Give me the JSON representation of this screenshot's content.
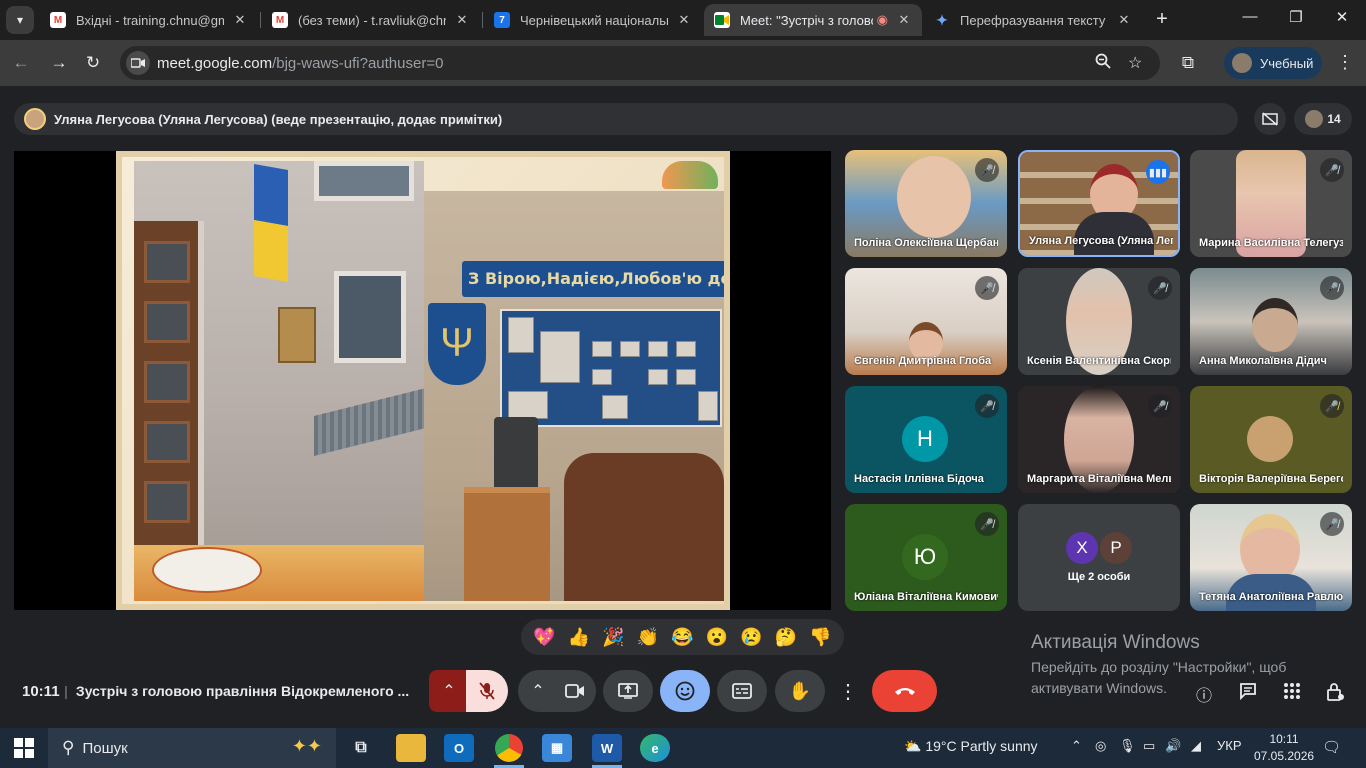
{
  "browser": {
    "tabs": [
      {
        "title": "Вхідні - training.chnu@gmail",
        "favicon": "gmail-icon"
      },
      {
        "title": "(без теми) - t.ravliuk@chnu.e",
        "favicon": "gmail-icon"
      },
      {
        "title": "Чернівецький національний",
        "favicon": "calendar-icon"
      },
      {
        "title": "Meet: \"Зустріч з головою",
        "favicon": "meet-icon"
      },
      {
        "title": "Перефразування тексту пр",
        "favicon": "gemini-icon"
      }
    ],
    "url_main": "meet.google.com",
    "url_rest": "/bjg-waws-ufi?authuser=0",
    "profile_label": "Учебный",
    "calendar_favicon_text": "7"
  },
  "meet": {
    "presenter_banner": "Уляна Легусова (Уляна Легусова) (веде презентацію, додає примітки)",
    "participant_count": "14",
    "slide": {
      "banner_text": "З Вірою,Надією,Любов'ю до Дітей",
      "trident": "Ψ"
    },
    "tiles": [
      {
        "name": "Поліна Олексіївна Щербан",
        "mic": "muted"
      },
      {
        "name": "Уляна Легусова (Уляна Легусова)",
        "mic": "speaking"
      },
      {
        "name": "Марина Василівна Телегуз",
        "mic": "muted"
      },
      {
        "name": "Євгенія Дмитрівна Глоба",
        "mic": "muted"
      },
      {
        "name": "Ксенія Валентинівна Скорик",
        "mic": "muted"
      },
      {
        "name": "Анна Миколаївна Дідич",
        "mic": "muted"
      },
      {
        "name": "Настасія Іллівна Бідоча",
        "mic": "muted",
        "initial": "Н"
      },
      {
        "name": "Маргарита Віталіївна Мельник",
        "mic": "muted"
      },
      {
        "name": "Вікторія Валеріївна Берегова",
        "mic": "muted"
      },
      {
        "name": "Юліана Віталіївна Кимович",
        "mic": "muted",
        "initial": "Ю"
      },
      {
        "name": "Ще 2 особи",
        "initials": [
          "Х",
          "Р"
        ]
      },
      {
        "name": "Тетяна Анатоліївна Равлюк",
        "mic": "muted"
      }
    ],
    "reactions": [
      "💖",
      "👍",
      "🎉",
      "👏",
      "😂",
      "😮",
      "😢",
      "🤔",
      "👎"
    ],
    "time": "10:11",
    "meeting_title": "Зустріч з головою правління Відокремленого ...",
    "activation_title": "Активація Windows",
    "activation_text": "Перейдіть до розділу \"Настройки\", щоб активувати Windows."
  },
  "taskbar": {
    "search_placeholder": "Пошук",
    "weather": "19°C  Partly sunny",
    "language": "УКР",
    "time": "10:11",
    "date": "07.05.2026"
  },
  "colors": {
    "meet_bg": "#202124",
    "end_call": "#ea4335",
    "emoji_active": "#8ab4f8",
    "speaking": "#1a73e8"
  }
}
